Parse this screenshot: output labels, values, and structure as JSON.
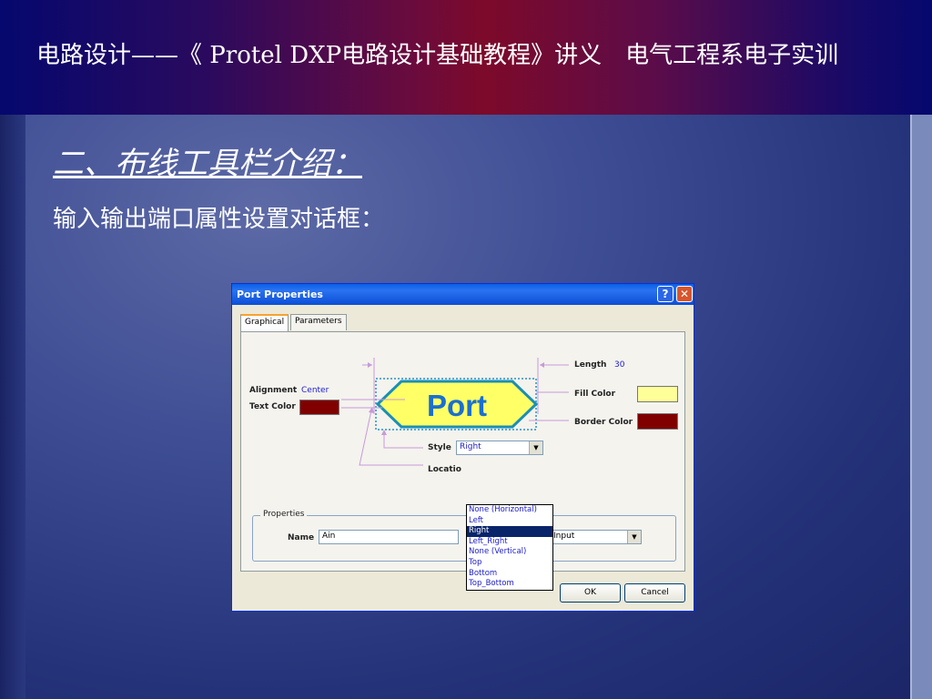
{
  "slide": {
    "header_title": "电路设计——《 Protel DXP电路设计基础教程》讲义　电气工程系电子实训",
    "section_title": "二、布线工具栏介绍：",
    "subtitle": "输入输出端口属性设置对话框："
  },
  "dialog": {
    "title": "Port Properties",
    "help_glyph": "?",
    "close_glyph": "✕",
    "tabs": [
      {
        "label": "Graphical",
        "active": true
      },
      {
        "label": "Parameters",
        "active": false
      }
    ],
    "graphical": {
      "port_text": "Port",
      "length_label": "Length",
      "length_value": "30",
      "alignment_label": "Alignment",
      "alignment_value": "Center",
      "text_color_label": "Text Color",
      "text_color": "#800000",
      "fill_color_label": "Fill Color",
      "fill_color": "#ffff99",
      "border_color_label": "Border Color",
      "border_color": "#800000",
      "style_label": "Style",
      "style_value": "Right",
      "location_label": "Locatio",
      "style_options": [
        "None (Horizontal)",
        "Left",
        "Right",
        "Left_Right",
        "None (Vertical)",
        "Top",
        "Bottom",
        "Top_Bottom"
      ],
      "style_selected_index": 2
    },
    "properties": {
      "group_label": "Properties",
      "name_label": "Name",
      "name_value": "Ain",
      "io_type_value": "Input"
    },
    "buttons": {
      "ok": "OK",
      "cancel": "Cancel"
    }
  },
  "colors": {
    "port_fill": "#ffff66",
    "port_border": "#1a8fb5",
    "port_text": "#1a6fd0",
    "guide_line": "#c89ad8"
  }
}
